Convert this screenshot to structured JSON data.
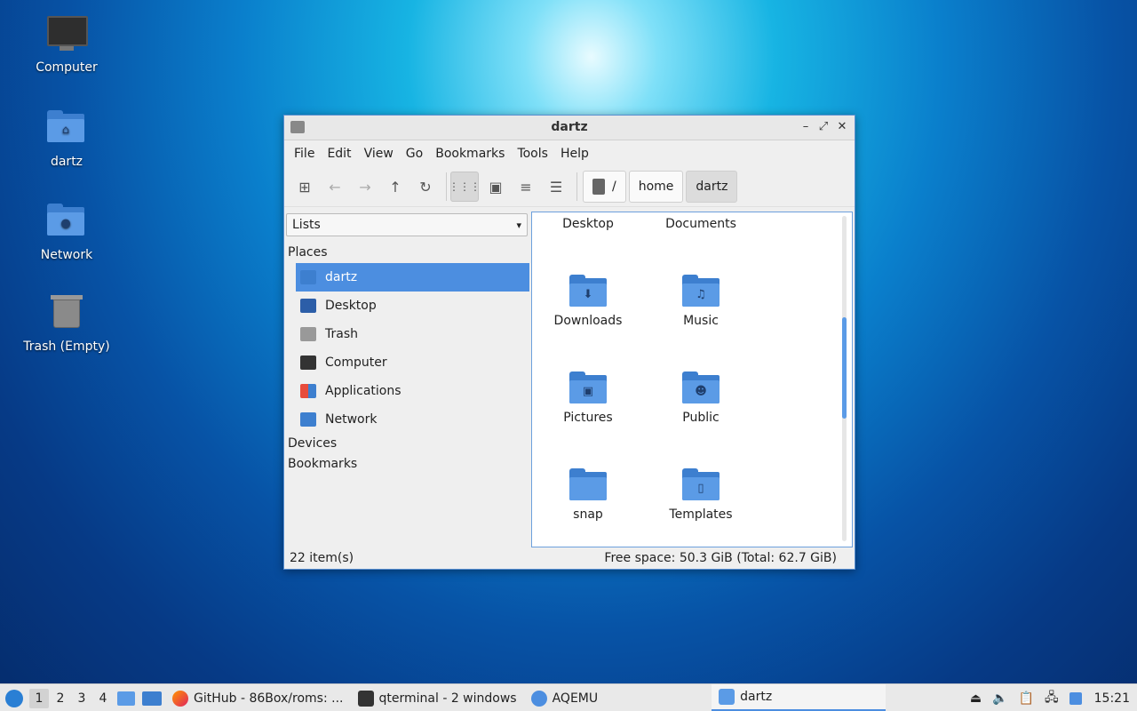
{
  "desktop": {
    "icons": [
      {
        "label": "Computer"
      },
      {
        "label": "dartz"
      },
      {
        "label": "Network"
      },
      {
        "label": "Trash (Empty)"
      }
    ]
  },
  "window": {
    "title": "dartz",
    "menu": [
      "File",
      "Edit",
      "View",
      "Go",
      "Bookmarks",
      "Tools",
      "Help"
    ],
    "breadcrumb": [
      "/",
      "home",
      "dartz"
    ],
    "sidebar": {
      "mode": "Lists",
      "sections": {
        "places": "Places",
        "devices": "Devices",
        "bookmarks": "Bookmarks"
      },
      "places": [
        "dartz",
        "Desktop",
        "Trash",
        "Computer",
        "Applications",
        "Network"
      ]
    },
    "files": [
      "Desktop",
      "Documents",
      "Downloads",
      "Music",
      "Pictures",
      "Public",
      "snap",
      "Templates"
    ],
    "status": {
      "items": "22 item(s)",
      "space": "Free space: 50.3 GiB (Total: 62.7 GiB)"
    }
  },
  "taskbar": {
    "workspaces": [
      "1",
      "2",
      "3",
      "4"
    ],
    "tasks": [
      "GitHub - 86Box/roms: ...",
      "qterminal - 2 windows",
      "AQEMU",
      "dartz"
    ],
    "clock": "15:21"
  },
  "colors": {
    "accent": "#4c8ee0",
    "folder": "#5b9be6"
  }
}
